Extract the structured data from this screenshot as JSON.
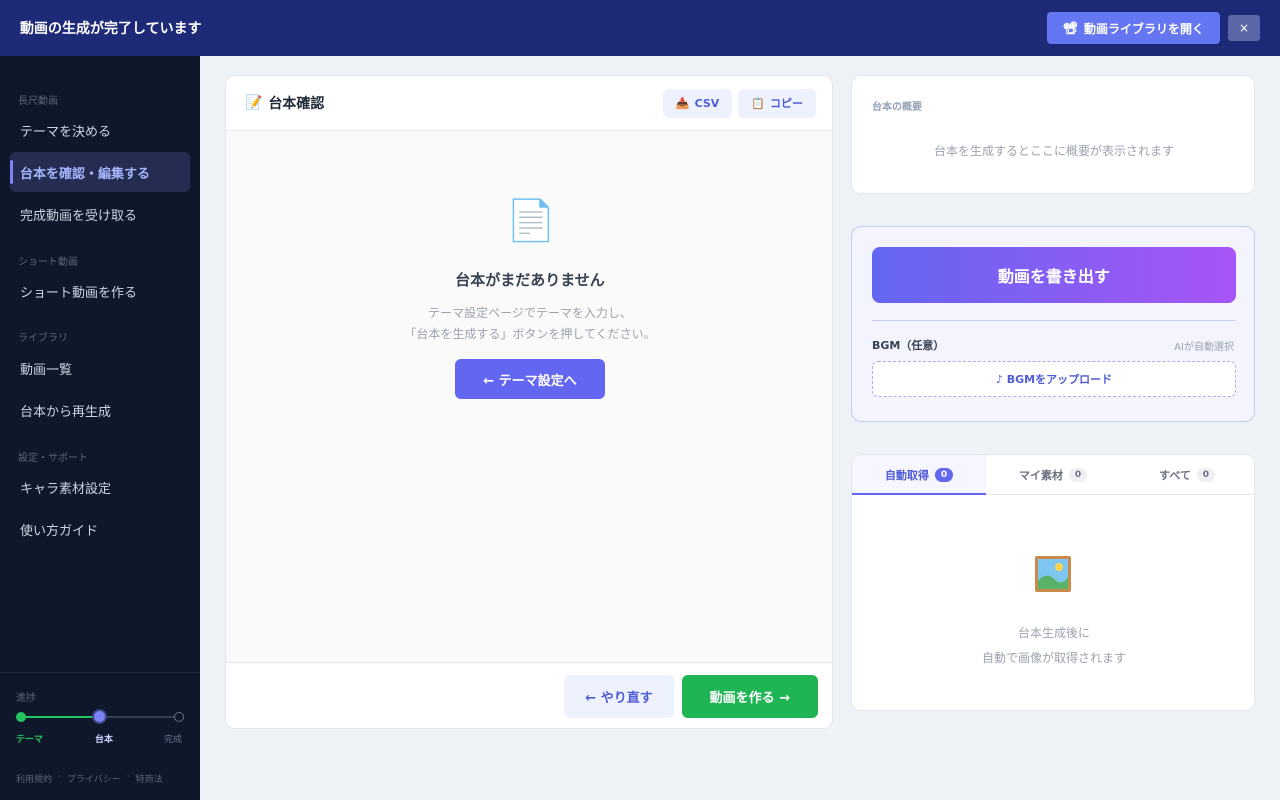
{
  "banner": {
    "title": "動画の生成が完了しています",
    "open_library_label": "動画ライブラリを開く",
    "close_label": "×"
  },
  "sidebar": {
    "sections": [
      {
        "title": "長尺動画",
        "items": [
          "テーマを決める",
          "台本を確認・編集する",
          "完成動画を受け取る"
        ]
      },
      {
        "title": "ショート動画",
        "items": [
          "ショート動画を作る"
        ]
      },
      {
        "title": "ライブラリ",
        "items": [
          "動画一覧",
          "台本から再生成"
        ]
      },
      {
        "title": "設定・サポート",
        "items": [
          "キャラ素材設定",
          "使い方ガイド"
        ]
      }
    ],
    "active_item": "台本を確認・編集する",
    "progress": {
      "label": "進捗",
      "steps": [
        "テーマ",
        "台本",
        "完成"
      ],
      "current_step": 2
    },
    "footer_links": [
      "利用規約",
      "·",
      "プライバシー",
      "·",
      "特商法"
    ]
  },
  "script_panel": {
    "title": "台本確認",
    "csv_label": "CSV",
    "copy_label": "コピー",
    "empty_title": "台本がまだありません",
    "empty_line1": "テーマ設定ページでテーマを入力し、",
    "empty_line2": "「台本を生成する」ボタンを押してください。",
    "theme_button": "← テーマ設定へ",
    "redo_button": "← やり直す",
    "make_button": "動画を作る →"
  },
  "summary": {
    "label": "台本の概要",
    "empty": "台本を生成するとここに概要が表示されます"
  },
  "export": {
    "button": "動画を書き出す",
    "bgm_label": "BGM（任意）",
    "bgm_hint": "AIが自動選択",
    "bgm_upload": "♪ BGMをアップロード"
  },
  "media": {
    "tabs": [
      {
        "label": "自動取得",
        "count": "0"
      },
      {
        "label": "マイ素材",
        "count": "0"
      },
      {
        "label": "すべて",
        "count": "0"
      }
    ],
    "empty_line1": "台本生成後に",
    "empty_line2": "自動で画像が取得されます"
  },
  "colors": {
    "banner": "#1e2a78",
    "sidebar": "#0f172a",
    "accent": "#6366f1",
    "success": "#1fb554"
  }
}
